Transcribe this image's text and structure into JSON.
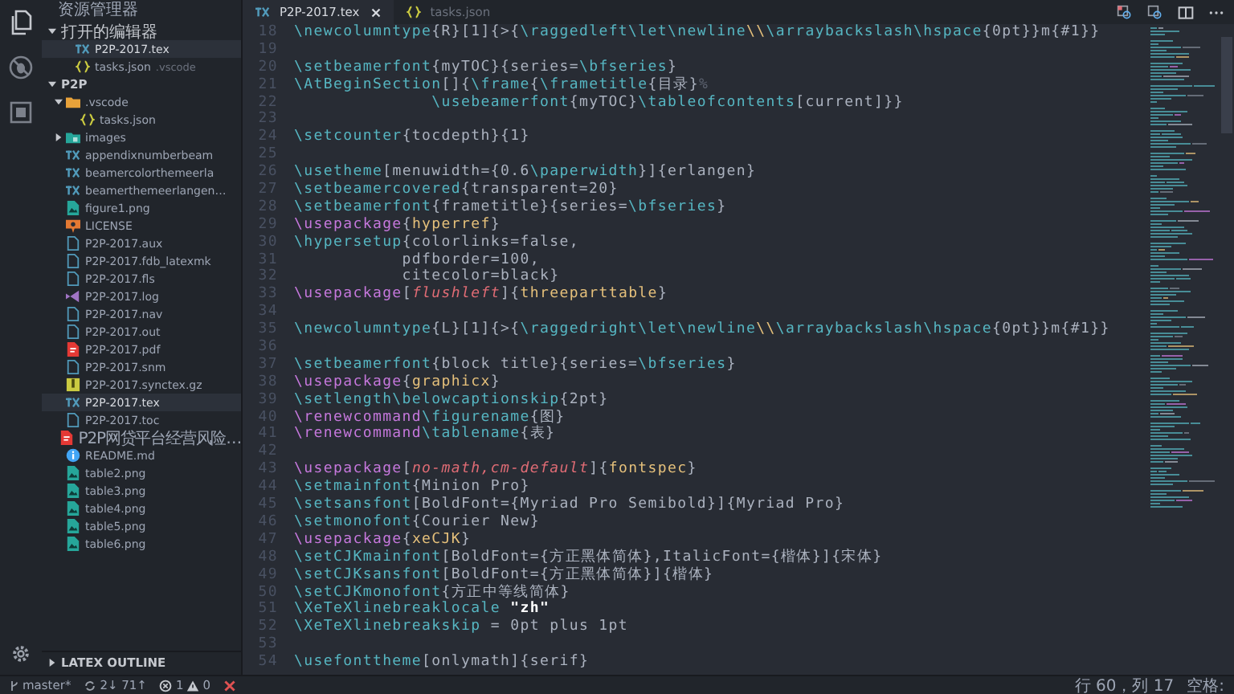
{
  "sidebar": {
    "title": "资源管理器",
    "open_editors": {
      "label": "打开的编辑器",
      "expanded": true,
      "items": [
        {
          "name": "P2P-2017.tex",
          "kind": "tex",
          "selected": true
        },
        {
          "name": "tasks.json",
          "kind": "json",
          "detail": ".vscode",
          "selected": false
        }
      ]
    },
    "folder": {
      "label": "P2P",
      "expanded": true,
      "children": [
        {
          "name": ".vscode",
          "kind": "folder",
          "expanded": true,
          "selected": false,
          "children": [
            {
              "name": "tasks.json",
              "kind": "json",
              "selected": false
            }
          ]
        },
        {
          "name": "images",
          "kind": "image-folder",
          "expanded": false,
          "selected": false
        },
        {
          "name": "appendixnumberbeam",
          "kind": "tex",
          "selected": false
        },
        {
          "name": "beamercolorthemeerla",
          "kind": "tex",
          "selected": false
        },
        {
          "name": "beamerthemeerlangen…",
          "kind": "tex",
          "selected": false
        },
        {
          "name": "figure1.png",
          "kind": "image",
          "selected": false
        },
        {
          "name": "LICENSE",
          "kind": "license",
          "selected": false
        },
        {
          "name": "P2P-2017.aux",
          "kind": "file",
          "selected": false
        },
        {
          "name": "P2P-2017.fdb_latexmk",
          "kind": "file",
          "selected": false
        },
        {
          "name": "P2P-2017.fls",
          "kind": "file",
          "selected": false
        },
        {
          "name": "P2P-2017.log",
          "kind": "log",
          "selected": false
        },
        {
          "name": "P2P-2017.nav",
          "kind": "file",
          "selected": false
        },
        {
          "name": "P2P-2017.out",
          "kind": "file",
          "selected": false
        },
        {
          "name": "P2P-2017.pdf",
          "kind": "pdf",
          "selected": false
        },
        {
          "name": "P2P-2017.snm",
          "kind": "file",
          "selected": false
        },
        {
          "name": "P2P-2017.synctex.gz",
          "kind": "gz",
          "selected": false
        },
        {
          "name": "P2P-2017.tex",
          "kind": "tex",
          "selected": true
        },
        {
          "name": "P2P-2017.toc",
          "kind": "file",
          "selected": false
        },
        {
          "name": "P2P网贷平台经营风险…",
          "kind": "pdf",
          "selected": false
        },
        {
          "name": "README.md",
          "kind": "info",
          "selected": false
        },
        {
          "name": "table2.png",
          "kind": "image",
          "selected": false
        },
        {
          "name": "table3.png",
          "kind": "image",
          "selected": false
        },
        {
          "name": "table4.png",
          "kind": "image",
          "selected": false
        },
        {
          "name": "table5.png",
          "kind": "image",
          "selected": false
        },
        {
          "name": "table6.png",
          "kind": "image",
          "selected": false
        }
      ]
    },
    "outline": {
      "label": "LATEX OUTLINE",
      "expanded": false
    }
  },
  "tabs": [
    {
      "label": "P2P-2017.tex",
      "kind": "tex",
      "selected": true
    },
    {
      "label": "tasks.json",
      "kind": "json",
      "selected": false
    }
  ],
  "lines": [
    {
      "n": "18",
      "tokens": [
        {
          "kind": "command",
          "t": "\\newcolumntype"
        },
        {
          "kind": "text",
          "t": "{R}[1]{>{"
        },
        {
          "kind": "command",
          "t": "\\raggedleft\\let\\newline"
        },
        {
          "kind": "package",
          "t": "\\\\"
        },
        {
          "kind": "command",
          "t": "\\arraybackslash\\hspace"
        },
        {
          "kind": "text",
          "t": "{0pt}}m{#1}}"
        }
      ]
    },
    {
      "n": "19"
    },
    {
      "n": "20",
      "tokens": [
        {
          "kind": "command",
          "t": "\\setbeamerfont"
        },
        {
          "kind": "text",
          "t": "{myTOC}{series="
        },
        {
          "kind": "command",
          "t": "\\bfseries"
        },
        {
          "kind": "text",
          "t": "}"
        }
      ]
    },
    {
      "n": "21",
      "tokens": [
        {
          "kind": "command",
          "t": "\\AtBeginSection"
        },
        {
          "kind": "text",
          "t": "[]{"
        },
        {
          "kind": "command",
          "t": "\\frame"
        },
        {
          "kind": "text",
          "t": "{"
        },
        {
          "kind": "command",
          "t": "\\frametitle"
        },
        {
          "kind": "text",
          "t": "{目录}"
        },
        {
          "kind": "comment",
          "t": "%"
        }
      ]
    },
    {
      "n": "22",
      "tokens": [
        {
          "kind": "command",
          "t": "              \\usebeamerfont"
        },
        {
          "kind": "text",
          "t": "{myTOC}"
        },
        {
          "kind": "command",
          "t": "\\tableofcontents"
        },
        {
          "kind": "text",
          "t": "[current]}}"
        }
      ]
    },
    {
      "n": "23"
    },
    {
      "n": "24",
      "tokens": [
        {
          "kind": "command",
          "t": "\\setcounter"
        },
        {
          "kind": "text",
          "t": "{tocdepth}{1}"
        }
      ]
    },
    {
      "n": "25"
    },
    {
      "n": "26",
      "tokens": [
        {
          "kind": "command",
          "t": "\\usetheme"
        },
        {
          "kind": "text",
          "t": "[menuwidth={0.6"
        },
        {
          "kind": "command",
          "t": "\\paperwidth"
        },
        {
          "kind": "text",
          "t": "}]{erlangen}"
        }
      ]
    },
    {
      "n": "27",
      "tokens": [
        {
          "kind": "command",
          "t": "\\setbeamercovered"
        },
        {
          "kind": "text",
          "t": "{transparent=20}"
        }
      ]
    },
    {
      "n": "28",
      "tokens": [
        {
          "kind": "command",
          "t": "\\setbeamerfont"
        },
        {
          "kind": "text",
          "t": "{frametitle}{series="
        },
        {
          "kind": "command",
          "t": "\\bfseries"
        },
        {
          "kind": "text",
          "t": "}"
        }
      ]
    },
    {
      "n": "29",
      "tokens": [
        {
          "kind": "keyword",
          "t": "\\usepackage"
        },
        {
          "kind": "text",
          "t": "{"
        },
        {
          "kind": "package",
          "t": "hyperref"
        },
        {
          "kind": "text",
          "t": "}"
        }
      ]
    },
    {
      "n": "30",
      "tokens": [
        {
          "kind": "command",
          "t": "\\hypersetup"
        },
        {
          "kind": "text",
          "t": "{colorlinks=false,"
        }
      ]
    },
    {
      "n": "31",
      "tokens": [
        {
          "kind": "text",
          "t": "           pdfborder=100,"
        }
      ]
    },
    {
      "n": "32",
      "tokens": [
        {
          "kind": "text",
          "t": "           citecolor=black}"
        }
      ]
    },
    {
      "n": "33",
      "tokens": [
        {
          "kind": "keyword",
          "t": "\\usepackage"
        },
        {
          "kind": "text",
          "t": "["
        },
        {
          "kind": "option",
          "t": "flushleft"
        },
        {
          "kind": "text",
          "t": "]{"
        },
        {
          "kind": "package",
          "t": "threeparttable"
        },
        {
          "kind": "text",
          "t": "}"
        }
      ]
    },
    {
      "n": "34"
    },
    {
      "n": "35",
      "tokens": [
        {
          "kind": "command",
          "t": "\\newcolumntype"
        },
        {
          "kind": "text",
          "t": "{L}[1]{>{"
        },
        {
          "kind": "command",
          "t": "\\raggedright\\let\\newline"
        },
        {
          "kind": "package",
          "t": "\\\\"
        },
        {
          "kind": "command",
          "t": "\\arraybackslash\\hspace"
        },
        {
          "kind": "text",
          "t": "{0pt}}m{#1}}"
        }
      ]
    },
    {
      "n": "36"
    },
    {
      "n": "37",
      "tokens": [
        {
          "kind": "command",
          "t": "\\setbeamerfont"
        },
        {
          "kind": "text",
          "t": "{block title}{series="
        },
        {
          "kind": "command",
          "t": "\\bfseries"
        },
        {
          "kind": "text",
          "t": "}"
        }
      ]
    },
    {
      "n": "38",
      "tokens": [
        {
          "kind": "keyword",
          "t": "\\usepackage"
        },
        {
          "kind": "text",
          "t": "{"
        },
        {
          "kind": "package",
          "t": "graphicx"
        },
        {
          "kind": "text",
          "t": "}"
        }
      ]
    },
    {
      "n": "39",
      "tokens": [
        {
          "kind": "command",
          "t": "\\setlength\\belowcaptionskip"
        },
        {
          "kind": "text",
          "t": "{2pt}"
        }
      ]
    },
    {
      "n": "40",
      "tokens": [
        {
          "kind": "keyword",
          "t": "\\renewcommand"
        },
        {
          "kind": "command",
          "t": "\\figurename"
        },
        {
          "kind": "text",
          "t": "{图}"
        }
      ]
    },
    {
      "n": "41",
      "tokens": [
        {
          "kind": "keyword",
          "t": "\\renewcommand"
        },
        {
          "kind": "command",
          "t": "\\tablename"
        },
        {
          "kind": "text",
          "t": "{表}"
        }
      ]
    },
    {
      "n": "42"
    },
    {
      "n": "43",
      "tokens": [
        {
          "kind": "keyword",
          "t": "\\usepackage"
        },
        {
          "kind": "text",
          "t": "["
        },
        {
          "kind": "option",
          "t": "no-math,cm-default"
        },
        {
          "kind": "text",
          "t": "]{"
        },
        {
          "kind": "package",
          "t": "fontspec"
        },
        {
          "kind": "text",
          "t": "}"
        }
      ]
    },
    {
      "n": "44",
      "tokens": [
        {
          "kind": "command",
          "t": "\\setmainfont"
        },
        {
          "kind": "text",
          "t": "{Minion Pro}"
        }
      ]
    },
    {
      "n": "45",
      "tokens": [
        {
          "kind": "command",
          "t": "\\setsansfont"
        },
        {
          "kind": "text",
          "t": "[BoldFont={Myriad Pro Semibold}]{Myriad Pro}"
        }
      ]
    },
    {
      "n": "46",
      "tokens": [
        {
          "kind": "command",
          "t": "\\setmonofont"
        },
        {
          "kind": "text",
          "t": "{Courier New}"
        }
      ]
    },
    {
      "n": "47",
      "tokens": [
        {
          "kind": "keyword",
          "t": "\\usepackage"
        },
        {
          "kind": "text",
          "t": "{"
        },
        {
          "kind": "package",
          "t": "xeCJK"
        },
        {
          "kind": "text",
          "t": "}"
        }
      ]
    },
    {
      "n": "48",
      "tokens": [
        {
          "kind": "command",
          "t": "\\setCJKmainfont"
        },
        {
          "kind": "text",
          "t": "[BoldFont={方正黑体简体},ItalicFont={楷体}]{宋体}"
        }
      ]
    },
    {
      "n": "49",
      "tokens": [
        {
          "kind": "command",
          "t": "\\setCJKsansfont"
        },
        {
          "kind": "text",
          "t": "[BoldFont={方正黑体简体}]{楷体}"
        }
      ]
    },
    {
      "n": "50",
      "tokens": [
        {
          "kind": "command",
          "t": "\\setCJKmonofont"
        },
        {
          "kind": "text",
          "t": "{方正中等线简体}"
        }
      ]
    },
    {
      "n": "51",
      "tokens": [
        {
          "kind": "command",
          "t": "\\XeTeXlinebreaklocale "
        },
        {
          "kind": "string",
          "t": "\"zh\""
        }
      ]
    },
    {
      "n": "52",
      "tokens": [
        {
          "kind": "command",
          "t": "\\XeTeXlinebreakskip"
        },
        {
          "kind": "text",
          "t": " = 0pt plus 1pt"
        }
      ]
    },
    {
      "n": "53"
    },
    {
      "n": "54",
      "tokens": [
        {
          "kind": "command",
          "t": "\\usefonttheme"
        },
        {
          "kind": "text",
          "t": "[onlymath]{serif}"
        }
      ]
    }
  ],
  "status_bar": {
    "branch": "master*",
    "sync": "2↓ 71↑",
    "errors": "1",
    "warnings": "0",
    "position": "行 60，列 17",
    "indent": "空格:"
  }
}
